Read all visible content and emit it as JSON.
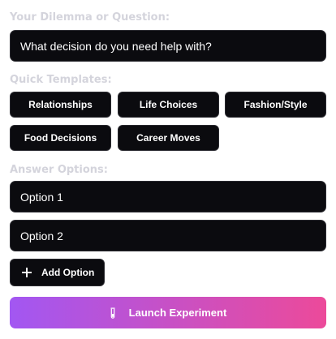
{
  "dilemma": {
    "label": "Your Dilemma or Question:",
    "placeholder": "What decision do you need help with?"
  },
  "templates": {
    "label": "Quick Templates:",
    "items": [
      {
        "label": "Relationships"
      },
      {
        "label": "Life Choices"
      },
      {
        "label": "Fashion/Style"
      },
      {
        "label": "Food Decisions"
      },
      {
        "label": "Career Moves"
      }
    ]
  },
  "answers": {
    "label": "Answer Options:",
    "options": [
      {
        "value": "Option 1"
      },
      {
        "value": "Option 2"
      }
    ],
    "add_label": "Add Option",
    "add_icon": "plus-icon"
  },
  "launch": {
    "label": "Launch Experiment",
    "icon": "test-tube-icon",
    "gradient_start": "#a257f2",
    "gradient_end": "#ec4a9a"
  },
  "colors": {
    "section_label": "#d4d4dc",
    "field_background": "#0b0b0f",
    "text": "#ffffff"
  }
}
